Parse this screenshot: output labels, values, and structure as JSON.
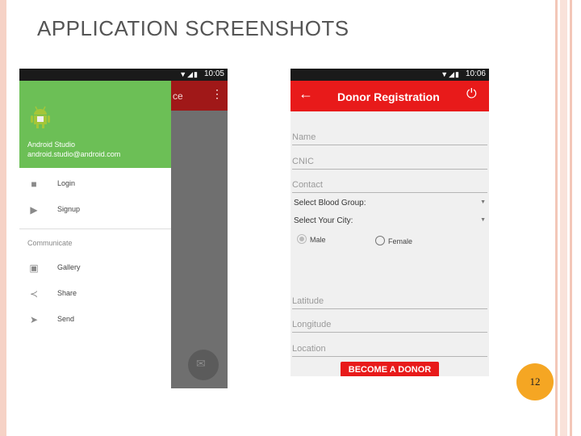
{
  "slide": {
    "title": "APPLICATION SCREENSHOTS",
    "page_number": "12"
  },
  "phone1": {
    "status_time": "10:05",
    "toolbar_partial_text": "ce",
    "drawer": {
      "user_name": "Android Studio",
      "user_email": "android.studio@android.com",
      "items": [
        {
          "label": "Login",
          "icon": "camera-icon"
        },
        {
          "label": "Signup",
          "icon": "play-icon"
        }
      ],
      "section_label": "Communicate",
      "section_items": [
        {
          "label": "Gallery",
          "icon": "image-icon"
        },
        {
          "label": "Share",
          "icon": "share-icon"
        },
        {
          "label": "Send",
          "icon": "send-icon"
        }
      ]
    }
  },
  "phone2": {
    "status_time": "10:06",
    "title": "Donor Registration",
    "fields": {
      "name": "Name",
      "cnic": "CNIC",
      "contact": "Contact",
      "latitude": "Latitude",
      "longitude": "Longitude",
      "location": "Location"
    },
    "selects": {
      "blood_group": "Select Blood Group:",
      "city": "Select Your City:"
    },
    "gender": {
      "male": "Male",
      "female": "Female",
      "selected": "male"
    },
    "submit_label": "BECOME A DONOR"
  },
  "colors": {
    "drawer_header": "#6cbf56",
    "toolbar_red": "#e81a1a",
    "page_badge": "#f5a623"
  }
}
